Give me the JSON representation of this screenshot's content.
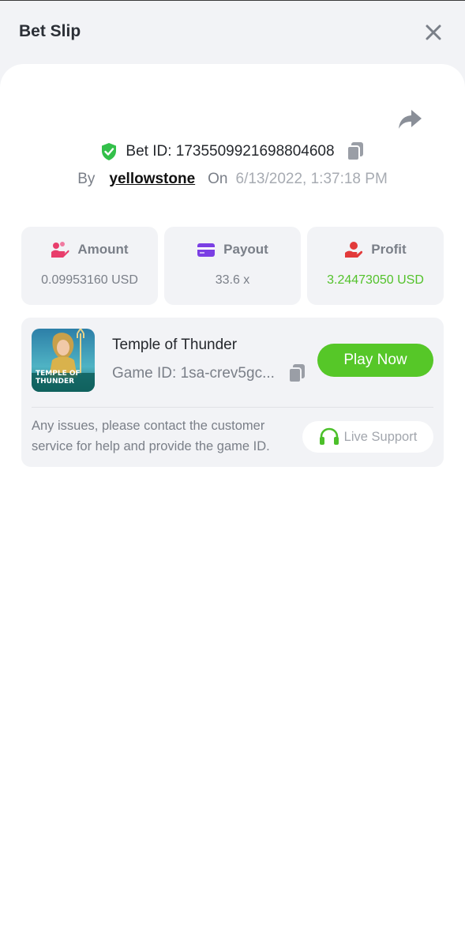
{
  "header": {
    "title": "Bet Slip",
    "close_icon": "close-icon"
  },
  "bet": {
    "id_text": "Bet ID: 1735509921698804608",
    "by_label": "By",
    "username": "yellowstone",
    "on_label": "On",
    "date": "6/13/2022, 1:37:18 PM"
  },
  "stats": {
    "amount": {
      "label": "Amount",
      "value": "0.09953160 USD",
      "icon": "coins-hand-icon",
      "icon_color": "#e83e6c"
    },
    "payout": {
      "label": "Payout",
      "value": "33.6 x",
      "icon": "card-icon",
      "icon_color": "#7b3fe4"
    },
    "profit": {
      "label": "Profit",
      "value": "3.24473050 USD",
      "icon": "hand-coin-icon",
      "icon_color": "#e23a3a",
      "value_color": "#53c22b"
    }
  },
  "game": {
    "name": "Temple of Thunder",
    "id_text": "Game ID: 1sa-crev5gc...",
    "thumb_text_1": "TEMPLE OF",
    "thumb_text_2": "THUNDER",
    "play_label": "Play Now"
  },
  "support": {
    "message": "Any issues, please contact the customer service for help and provide the game ID.",
    "button_label": "Live Support"
  },
  "colors": {
    "accent_green": "#56c728",
    "background": "#f2f3f6",
    "muted_text": "#7a7f88"
  }
}
